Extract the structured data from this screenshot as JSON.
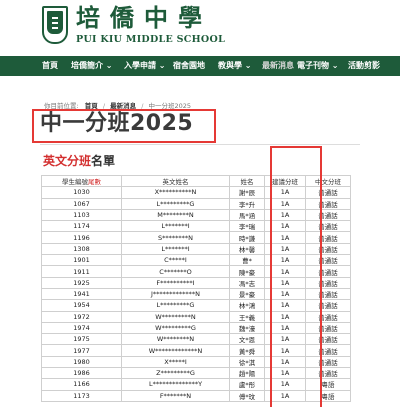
{
  "header": {
    "school_cn": "培僑中學",
    "school_en": "PUI KIU MIDDLE SCHOOL"
  },
  "nav": {
    "items": [
      "首頁",
      "培僑簡介 ⌄",
      "入學申請 ⌄",
      "宿舍園地",
      "教與學 ⌄",
      "最新消息",
      "電子刊物 ⌄",
      "活動剪影"
    ]
  },
  "breadcrumb": {
    "prefix": "你目前位置:",
    "items": [
      "首頁",
      "最新消息",
      "中一分班2025"
    ]
  },
  "page_title": "中一分班2025",
  "subheading": {
    "red": "英文分班",
    "black": "名單"
  },
  "table": {
    "headers": {
      "student_no_prefix": "學生編號",
      "student_no_red": "尾數",
      "eng_name": "英文姓名",
      "name": "姓名",
      "class": "建議分班",
      "chinese_class": "中文分班"
    },
    "rows": [
      [
        "1030",
        "X**********N",
        "謝*辰",
        "1A",
        "普通話"
      ],
      [
        "1067",
        "L*********G",
        "李*升",
        "1A",
        "普通話"
      ],
      [
        "1103",
        "M********N",
        "馬*涵",
        "1A",
        "普通話"
      ],
      [
        "1174",
        "L*******I",
        "李*瑞",
        "1A",
        "普通話"
      ],
      [
        "1196",
        "S********N",
        "時*謙",
        "1A",
        "普通話"
      ],
      [
        "1308",
        "L*******I",
        "林*馨",
        "1A",
        "普通話"
      ],
      [
        "1901",
        "C*****I",
        "曹*",
        "1A",
        "普通話"
      ],
      [
        "1911",
        "C*******O",
        "陳*豪",
        "1A",
        "普通話"
      ],
      [
        "1925",
        "F**********I",
        "馮*志",
        "1A",
        "普通話"
      ],
      [
        "1941",
        "J*************N",
        "景*豪",
        "1A",
        "普通話"
      ],
      [
        "1954",
        "L*********G",
        "林*鴻",
        "1A",
        "普通話"
      ],
      [
        "1972",
        "W*********N",
        "王*義",
        "1A",
        "普通話"
      ],
      [
        "1974",
        "W*********G",
        "魏*濠",
        "1A",
        "普通話"
      ],
      [
        "1975",
        "W********N",
        "文*恩",
        "1A",
        "普通話"
      ],
      [
        "1977",
        "W*************N",
        "黃*舜",
        "1A",
        "普通話"
      ],
      [
        "1980",
        "X*****I",
        "徐*淇",
        "1A",
        "普通話"
      ],
      [
        "1986",
        "Z*********G",
        "趙*陽",
        "1A",
        "普通話"
      ],
      [
        "1166",
        "L**************Y",
        "盧*彤",
        "1A",
        "粵語"
      ],
      [
        "1173",
        "F*******N",
        "傅*玟",
        "1A",
        "粵語"
      ]
    ]
  }
}
